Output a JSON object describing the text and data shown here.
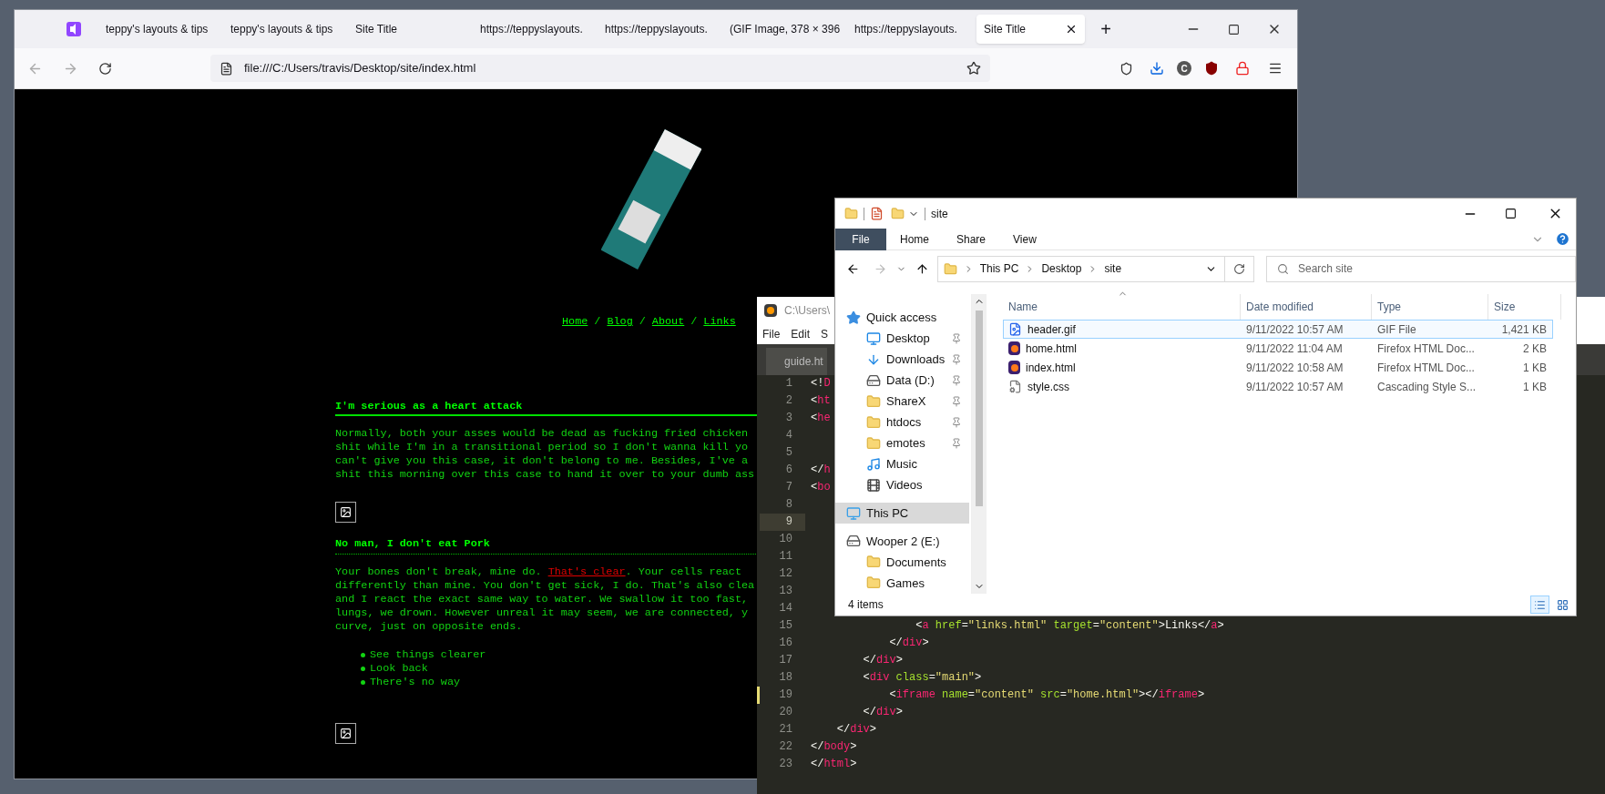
{
  "browser": {
    "tabs": [
      {
        "title": "teppy's layouts & tips",
        "selected": false
      },
      {
        "title": "teppy's layouts & tips",
        "selected": false
      },
      {
        "title": "Site Title",
        "selected": false
      },
      {
        "title": "https://teppyslayouts.",
        "selected": false
      },
      {
        "title": "https://teppyslayouts.",
        "selected": false
      },
      {
        "title": "(GIF Image, 378 × 396",
        "selected": false
      },
      {
        "title": "https://teppyslayouts.",
        "selected": false
      },
      {
        "title": "Site Title",
        "selected": true
      }
    ],
    "new_tab": "+",
    "address": "file:///C:/Users/travis/Desktop/site/index.html",
    "account": "C",
    "page": {
      "nav": [
        {
          "kind": "link",
          "text": "Home"
        },
        {
          "kind": "separator",
          "text": "/"
        },
        {
          "kind": "link",
          "text": "Blog"
        },
        {
          "kind": "separator",
          "text": "/"
        },
        {
          "kind": "link",
          "text": "About"
        },
        {
          "kind": "separator",
          "text": "/"
        },
        {
          "kind": "link",
          "text": "Links"
        }
      ],
      "blocks": [
        {
          "kind": "heading",
          "text": "I'm serious as a heart attack",
          "dotted": false
        },
        {
          "kind": "paragraph",
          "lines": [
            [
              {
                "kind": "text",
                "text": "Normally, both your asses would be dead as fucking fried chicken"
              }
            ],
            [
              {
                "kind": "text",
                "text": "shit while I'm in a transitional period so I don't wanna kill yo"
              }
            ],
            [
              {
                "kind": "text",
                "text": "can't give you this case, it don't belong to me. Besides, I've a"
              }
            ],
            [
              {
                "kind": "text",
                "text": "shit this morning over this case to hand it over to your dumb ass"
              }
            ]
          ]
        },
        {
          "kind": "image"
        },
        {
          "kind": "heading",
          "text": "No man, I don't eat Pork",
          "dotted": true
        },
        {
          "kind": "paragraph",
          "lines": [
            [
              {
                "kind": "text",
                "text": "Your bones don't break, mine do. "
              },
              {
                "kind": "link",
                "text": "That's clear"
              },
              {
                "kind": "text",
                "text": ". Your cells react"
              }
            ],
            [
              {
                "kind": "text",
                "text": "differently than mine. You don't get sick, I do. That's also clea"
              }
            ],
            [
              {
                "kind": "text",
                "text": "and I react the exact same way to water. We swallow it too fast,"
              }
            ],
            [
              {
                "kind": "text",
                "text": "lungs, we drown. However unreal it may seem, we are connected, y"
              }
            ],
            [
              {
                "kind": "text",
                "text": "curve, just on opposite ends."
              }
            ]
          ]
        },
        {
          "kind": "list",
          "items": [
            "See things clearer",
            "Look back",
            "There's no way"
          ]
        },
        {
          "kind": "image"
        }
      ]
    }
  },
  "editor": {
    "title": "C:\\Users\\",
    "menu": [
      "File",
      "Edit",
      "S"
    ],
    "tab": "guide.ht",
    "lines": [
      {
        "number": "1",
        "current": false,
        "modified": false,
        "tokens": [
          {
            "kind": "punct",
            "text": "<!"
          },
          {
            "kind": "tag",
            "text": "D"
          }
        ]
      },
      {
        "number": "2",
        "current": false,
        "modified": false,
        "tokens": [
          {
            "kind": "punct",
            "text": "<"
          },
          {
            "kind": "tag",
            "text": "ht"
          }
        ]
      },
      {
        "number": "3",
        "current": false,
        "modified": false,
        "tokens": [
          {
            "kind": "punct",
            "text": "<"
          },
          {
            "kind": "tag",
            "text": "he"
          }
        ]
      },
      {
        "number": "4",
        "current": false,
        "modified": false
      },
      {
        "number": "5",
        "current": false,
        "modified": false
      },
      {
        "number": "6",
        "current": false,
        "modified": false,
        "tokens": [
          {
            "kind": "punct",
            "text": "</"
          },
          {
            "kind": "tag",
            "text": "h"
          }
        ]
      },
      {
        "number": "7",
        "current": false,
        "modified": false,
        "tokens": [
          {
            "kind": "punct",
            "text": "<"
          },
          {
            "kind": "tag",
            "text": "bo"
          }
        ]
      },
      {
        "number": "8",
        "current": false,
        "modified": false
      },
      {
        "number": "9",
        "current": true,
        "modified": false
      },
      {
        "number": "10",
        "current": false,
        "modified": false
      },
      {
        "number": "11",
        "current": false,
        "modified": false
      },
      {
        "number": "12",
        "current": false,
        "modified": false
      },
      {
        "number": "13",
        "current": false,
        "modified": false
      },
      {
        "number": "14",
        "current": false,
        "modified": false
      },
      {
        "number": "15",
        "current": false,
        "modified": false,
        "tokens": [
          {
            "kind": "punct",
            "text": "                <"
          },
          {
            "kind": "tag",
            "text": "a"
          },
          {
            "kind": "attr",
            "text": " href"
          },
          {
            "kind": "punct",
            "text": "="
          },
          {
            "kind": "string",
            "text": "\"links.html\""
          },
          {
            "kind": "attr",
            "text": " target"
          },
          {
            "kind": "punct",
            "text": "="
          },
          {
            "kind": "string",
            "text": "\"content\""
          },
          {
            "kind": "punct",
            "text": ">Links</"
          },
          {
            "kind": "tag",
            "text": "a"
          },
          {
            "kind": "punct",
            "text": ">"
          }
        ]
      },
      {
        "number": "16",
        "current": false,
        "modified": false,
        "tokens": [
          {
            "kind": "punct",
            "text": "            </"
          },
          {
            "kind": "tag",
            "text": "div"
          },
          {
            "kind": "punct",
            "text": ">"
          }
        ]
      },
      {
        "number": "17",
        "current": false,
        "modified": false,
        "tokens": [
          {
            "kind": "punct",
            "text": "        </"
          },
          {
            "kind": "tag",
            "text": "div"
          },
          {
            "kind": "punct",
            "text": ">"
          }
        ]
      },
      {
        "number": "18",
        "current": false,
        "modified": false,
        "tokens": [
          {
            "kind": "punct",
            "text": "        <"
          },
          {
            "kind": "tag",
            "text": "div"
          },
          {
            "kind": "attr",
            "text": " class"
          },
          {
            "kind": "punct",
            "text": "="
          },
          {
            "kind": "string",
            "text": "\"main\""
          },
          {
            "kind": "punct",
            "text": ">"
          }
        ]
      },
      {
        "number": "19",
        "current": false,
        "modified": true,
        "tokens": [
          {
            "kind": "punct",
            "text": "            <"
          },
          {
            "kind": "tag",
            "text": "iframe"
          },
          {
            "kind": "attr",
            "text": " name"
          },
          {
            "kind": "punct",
            "text": "="
          },
          {
            "kind": "string",
            "text": "\"content\""
          },
          {
            "kind": "attr",
            "text": " src"
          },
          {
            "kind": "punct",
            "text": "="
          },
          {
            "kind": "string",
            "text": "\"home.html\""
          },
          {
            "kind": "punct",
            "text": "></"
          },
          {
            "kind": "tag",
            "text": "iframe"
          },
          {
            "kind": "punct",
            "text": ">"
          }
        ]
      },
      {
        "number": "20",
        "current": false,
        "modified": false,
        "tokens": [
          {
            "kind": "punct",
            "text": "        </"
          },
          {
            "kind": "tag",
            "text": "div"
          },
          {
            "kind": "punct",
            "text": ">"
          }
        ]
      },
      {
        "number": "21",
        "current": false,
        "modified": false,
        "tokens": [
          {
            "kind": "punct",
            "text": "    </"
          },
          {
            "kind": "tag",
            "text": "div"
          },
          {
            "kind": "punct",
            "text": ">"
          }
        ]
      },
      {
        "number": "22",
        "current": false,
        "modified": false,
        "tokens": [
          {
            "kind": "punct",
            "text": "</"
          },
          {
            "kind": "tag",
            "text": "body"
          },
          {
            "kind": "punct",
            "text": ">"
          }
        ]
      },
      {
        "number": "23",
        "current": false,
        "modified": false,
        "tokens": [
          {
            "kind": "punct",
            "text": "</"
          },
          {
            "kind": "tag",
            "text": "html"
          },
          {
            "kind": "punct",
            "text": ">"
          }
        ]
      }
    ]
  },
  "explorer": {
    "title": "site",
    "ribbon": [
      {
        "label": "File",
        "kind": "menu"
      },
      {
        "label": "Home",
        "kind": "tab"
      },
      {
        "label": "Share",
        "kind": "tab"
      },
      {
        "label": "View",
        "kind": "tab"
      }
    ],
    "path": [
      "This PC",
      "Desktop",
      "site"
    ],
    "search_placeholder": "Search site",
    "nav": [
      {
        "label": "Quick access",
        "kind": "star",
        "selected": false,
        "children": [
          {
            "label": "Desktop",
            "kind": "desktop",
            "selected": false,
            "pinned": true
          },
          {
            "label": "Downloads",
            "kind": "download",
            "selected": false,
            "pinned": true
          },
          {
            "label": "Data (D:)",
            "kind": "drive",
            "selected": false,
            "pinned": true
          },
          {
            "label": "ShareX",
            "kind": "folder",
            "selected": false,
            "pinned": true
          },
          {
            "label": "htdocs",
            "kind": "folder",
            "selected": false,
            "pinned": true
          },
          {
            "label": "emotes",
            "kind": "folder",
            "selected": false,
            "pinned": true
          },
          {
            "label": "Music",
            "kind": "music",
            "selected": false,
            "pinned": false
          },
          {
            "label": "Videos",
            "kind": "video",
            "selected": false,
            "pinned": false
          }
        ]
      },
      {
        "label": "This PC",
        "kind": "pc",
        "selected": true
      },
      {
        "label": "Wooper 2 (E:)",
        "kind": "drive",
        "selected": false,
        "children": [
          {
            "label": "Documents",
            "kind": "folder",
            "selected": false,
            "pinned": false
          },
          {
            "label": "Games",
            "kind": "folder",
            "selected": false,
            "pinned": false
          }
        ]
      }
    ],
    "columns": [
      "Name",
      "Date modified",
      "Type",
      "Size"
    ],
    "rows": [
      {
        "name": "header.gif",
        "kind": "image",
        "date": "9/11/2022 10:57 AM",
        "type": "GIF File",
        "size": "1,421 KB",
        "selected": true
      },
      {
        "name": "home.html",
        "kind": "browser",
        "date": "9/11/2022 11:04 AM",
        "type": "Firefox HTML Doc...",
        "size": "2 KB",
        "selected": false
      },
      {
        "name": "index.html",
        "kind": "browser",
        "date": "9/11/2022 10:58 AM",
        "type": "Firefox HTML Doc...",
        "size": "1 KB",
        "selected": false
      },
      {
        "name": "style.css",
        "kind": "css",
        "date": "9/11/2022 10:57 AM",
        "type": "Cascading Style S...",
        "size": "1 KB",
        "selected": false
      }
    ],
    "status": "4 items",
    "views": [
      {
        "kind": "details",
        "selected": true
      },
      {
        "kind": "thumbnails",
        "selected": false
      }
    ]
  }
}
